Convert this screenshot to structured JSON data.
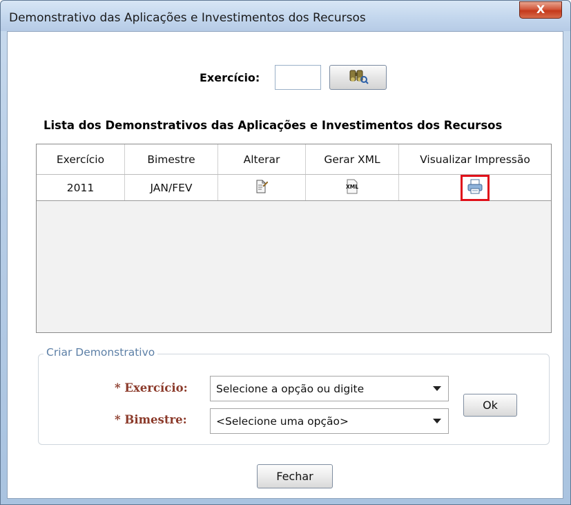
{
  "window": {
    "title": "Demonstrativo das Aplicações e Investimentos dos Recursos",
    "close_label": "X"
  },
  "search": {
    "label": "Exercício:",
    "value": "",
    "button_icon": "binoculars-search-icon"
  },
  "list": {
    "title": "Lista dos Demonstrativos das Aplicações e Investimentos dos Recursos",
    "columns": [
      "Exercício",
      "Bimestre",
      "Alterar",
      "Gerar XML",
      "Visualizar Impressão"
    ],
    "rows": [
      {
        "exercicio": "2011",
        "bimestre": "JAN/FEV",
        "alterar_icon": "edit-document-icon",
        "xml_icon": "xml-file-icon",
        "print_icon": "print-preview-icon"
      }
    ]
  },
  "create": {
    "legend": "Criar Demonstrativo",
    "exercicio_label": "* Exercício:",
    "exercicio_value": "Selecione a opção ou digite",
    "bimestre_label": "* Bimestre:",
    "bimestre_value": "<Selecione uma opção>",
    "ok_label": "Ok"
  },
  "footer": {
    "close_label": "Fechar"
  },
  "colors": {
    "highlight": "#e0101a",
    "label_required": "#8b3a2a",
    "legend": "#5c7fa6"
  }
}
